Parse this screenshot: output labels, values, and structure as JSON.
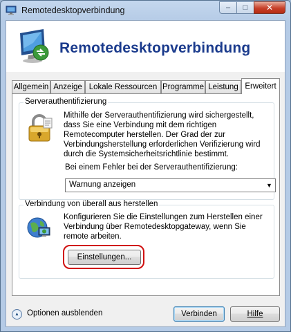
{
  "window": {
    "title": "Remotedesktopverbindung",
    "controls": {
      "minimize": "–",
      "maximize": "□",
      "close": "✕"
    }
  },
  "banner": {
    "title": "Remotedesktopverbindung"
  },
  "tabs": [
    {
      "label": "Allgemein"
    },
    {
      "label": "Anzeige"
    },
    {
      "label": "Lokale Ressourcen"
    },
    {
      "label": "Programme"
    },
    {
      "label": "Leistung"
    },
    {
      "label": "Erweitert",
      "active": true
    }
  ],
  "server_auth": {
    "legend": "Serverauthentifizierung",
    "description": "Mithilfe der Serverauthentifizierung wird sichergestellt, dass Sie eine Verbindung mit dem richtigen Remotecomputer herstellen. Der Grad der zur Verbindungsherstellung erforderlichen Verifizierung wird durch die Systemsicherheitsrichtlinie bestimmt.",
    "select_label": "Bei einem Fehler bei der Serverauthentifizierung:",
    "select_value": "Warnung anzeigen"
  },
  "connect_anywhere": {
    "legend": "Verbindung von überall aus herstellen",
    "description": "Konfigurieren Sie die Einstellungen zum Herstellen einer Verbindung über Remotedesktopgateway, wenn Sie remote arbeiten.",
    "settings_button": "Einstellungen..."
  },
  "footer": {
    "options_toggle": "Optionen ausblenden",
    "connect_button": "Verbinden",
    "help_button": "Hilfe"
  },
  "colors": {
    "banner_title": "#1a3a8c",
    "highlight_ring": "#d01010",
    "close_button": "#c7402a"
  }
}
